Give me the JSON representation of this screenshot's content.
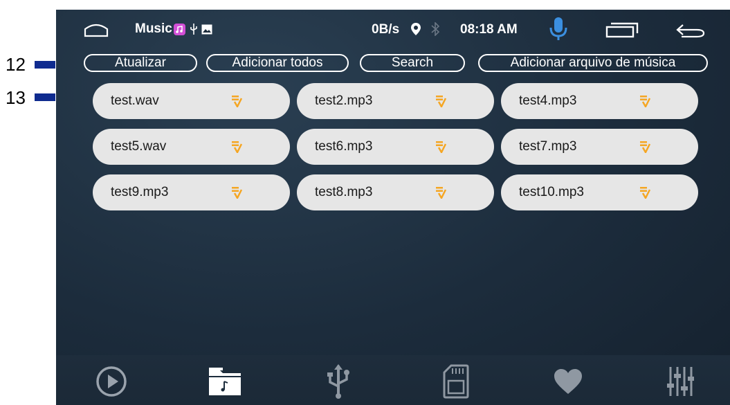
{
  "callouts": [
    {
      "number": "12"
    },
    {
      "number": "13"
    }
  ],
  "status": {
    "app_name": "Music",
    "net_speed": "0B/s",
    "time": "08:18 AM"
  },
  "toolbar": {
    "refresh_label": "Atualizar",
    "add_all_label": "Adicionar todos",
    "search_label": "Search",
    "add_file_label": "Adicionar arquivo de música"
  },
  "files": [
    {
      "name": "test.wav"
    },
    {
      "name": "test2.mp3"
    },
    {
      "name": "test4.mp3"
    },
    {
      "name": "test5.wav"
    },
    {
      "name": "test6.mp3"
    },
    {
      "name": "test7.mp3"
    },
    {
      "name": "test9.mp3"
    },
    {
      "name": "test8.mp3"
    },
    {
      "name": "test10.mp3"
    }
  ],
  "icons": {
    "file_action": "music-file-icon",
    "nav": [
      "play-icon",
      "music-folder-icon",
      "usb-icon",
      "sd-card-icon",
      "heart-icon",
      "equalizer-icon"
    ]
  },
  "colors": {
    "screen_bg": "#1c2c3c",
    "tile_bg": "#e6e6e6",
    "accent_orange": "#f5a623",
    "mic_blue": "#3b8fe0",
    "callout_arrow": "#ffff00",
    "callout_bar": "#0f2b8f"
  }
}
